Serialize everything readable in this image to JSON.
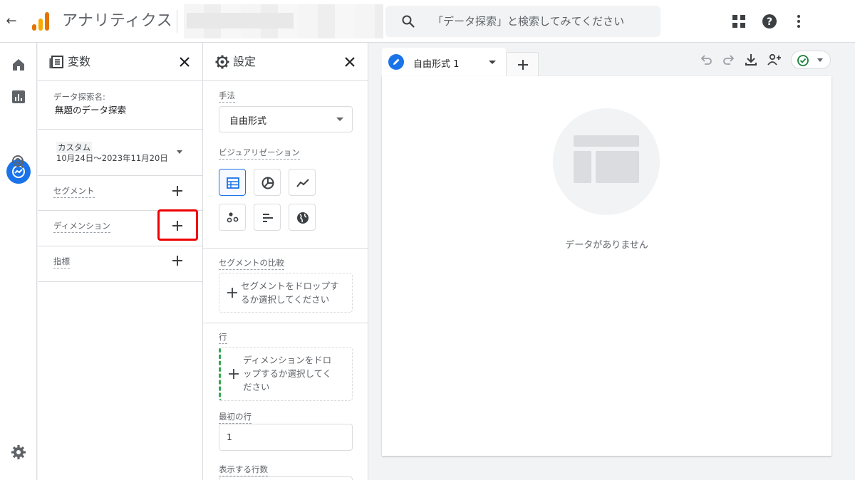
{
  "header": {
    "back_icon": "arrow-back-icon",
    "app_title": "アナリティクス",
    "search_placeholder": "「データ探索」と検索してみてください",
    "icons": [
      "apps-grid-icon",
      "help-icon",
      "more-vert-icon"
    ],
    "accent_color": "#1a73e8"
  },
  "rail": {
    "items": [
      "home-icon",
      "reports-icon",
      "explore-icon",
      "advertising-icon"
    ],
    "active": "explore-icon",
    "bottom": "settings-gear-icon"
  },
  "variables": {
    "title": "変数",
    "exploration_name_label": "データ探索名:",
    "exploration_name": "無題のデータ探索",
    "date_tag": "カスタム",
    "date_range": "10月24日～2023年11月20日",
    "segments_label": "セグメント",
    "dimensions_label": "ディメンション",
    "metrics_label": "指標"
  },
  "settings": {
    "title": "設定",
    "technique_label": "手法",
    "technique_value": "自由形式",
    "visualization_label": "ビジュアリゼーション",
    "visualizations": [
      "table-icon",
      "donut-chart-icon",
      "line-chart-icon",
      "scatter-icon",
      "bar-chart-icon",
      "geo-map-icon"
    ],
    "segment_compare_label": "セグメントの比較",
    "segment_drop_line1": "セグメントをドロップす",
    "segment_drop_line2": "るか選択してください",
    "rows_label": "行",
    "rows_drop_line1": "ディメンションをドロ",
    "rows_drop_line2": "ップするか選択してく",
    "rows_drop_line3": "ださい",
    "first_row_label": "最初の行",
    "first_row_value": "1",
    "show_rows_label": "表示する行数"
  },
  "canvas": {
    "tab_label": "自由形式 1",
    "toolbar_icons": [
      "undo-icon",
      "redo-icon",
      "download-icon",
      "share-user-icon",
      "check-circle-icon"
    ],
    "empty_text": "データがありません"
  }
}
